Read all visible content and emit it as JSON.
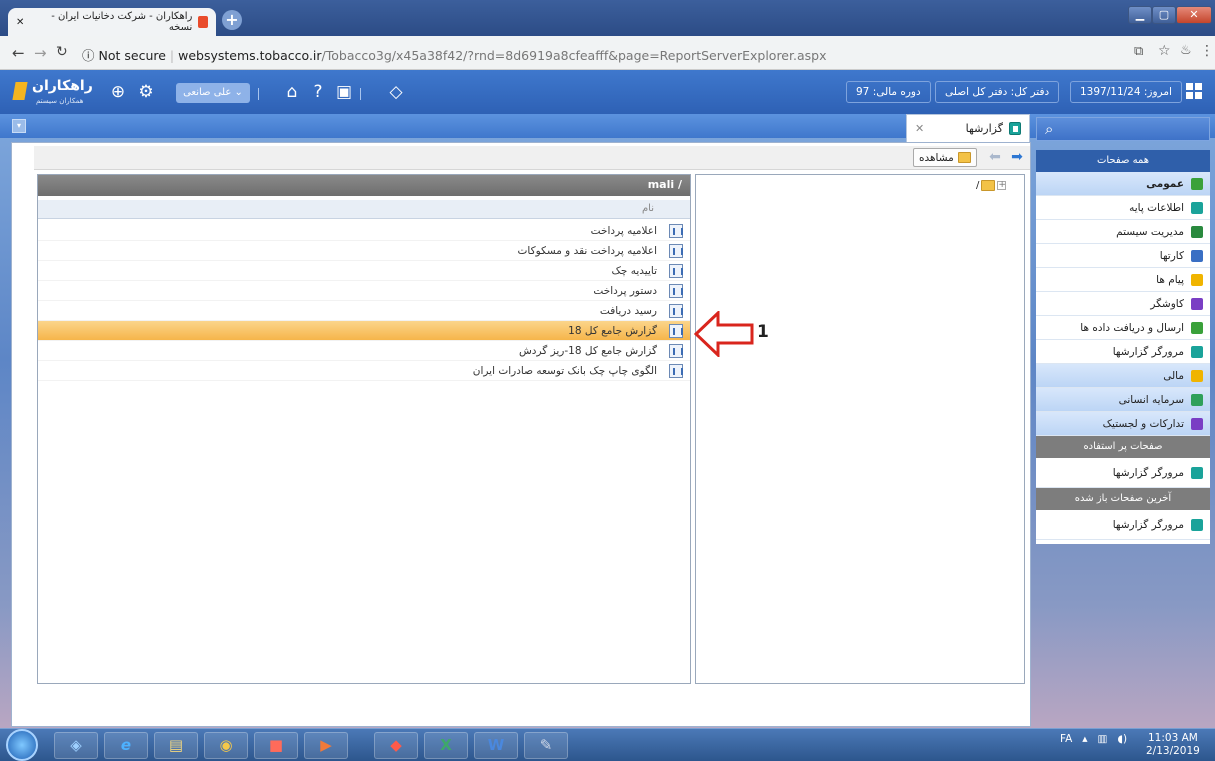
{
  "browser": {
    "tab_title": "راهکاران - شرکت دخانیات ایران - نسخه",
    "new_tab": "+",
    "url_security": "Not secure",
    "url_host": "websystems.tobacco.ir",
    "url_path": "/Tobacco3g/x45a38f42/?rnd=8d6919a8cfeafff&page=ReportServerExplorer.aspx"
  },
  "header": {
    "logo_text": "راهکاران",
    "logo_sub": "همکاران سیستم",
    "user_name": "علی صانعی",
    "today": "امروز: 1397/11/24",
    "office": "دفتر کل: دفتر کل اصلی",
    "fiscal_period": "دوره مالی: 97"
  },
  "tabs": {
    "reports": "گزارشها"
  },
  "toolbar": {
    "view_label": "مشاهده"
  },
  "tree": {
    "root": "/"
  },
  "list": {
    "path": "mali /",
    "column_name": "نام",
    "rows": [
      "اعلامیه پرداخت",
      "اعلامیه پرداخت نقد و مسکوکات",
      "تاییدیه چک",
      "دستور پرداخت",
      "رسید دریافت",
      "گزارش جامع کل 18",
      "گزارش جامع کل 18-ریز گردش",
      "الگوی چاپ چک بانک توسعه صادرات ایران"
    ],
    "selected_index": 5,
    "annotation": "1"
  },
  "sidebar": {
    "all_pages": "همه صفحات",
    "items": [
      {
        "label": "عمومی",
        "color": "#3aa13a"
      },
      {
        "label": "اطلاعات پایه",
        "color": "#1aa39a"
      },
      {
        "label": "مدیریت سیستم",
        "color": "#2a8a3e"
      },
      {
        "label": "کارتها",
        "color": "#3a6fc4"
      },
      {
        "label": "پیام ها",
        "color": "#f0b400"
      },
      {
        "label": "کاوشگر",
        "color": "#7a3ec4"
      },
      {
        "label": "ارسال و دریافت داده ها",
        "color": "#3aa13a"
      },
      {
        "label": "مرورگر گزارشها",
        "color": "#1aa39a"
      },
      {
        "label": "مالی",
        "color": "#f0b400"
      },
      {
        "label": "سرمایه انسانی",
        "color": "#2fa05a"
      },
      {
        "label": "تدارکات و لجستیک",
        "color": "#7a3ec4"
      }
    ],
    "frequent_title": "صفحات پر استفاده",
    "frequent_items": [
      "مرورگر گزارشها"
    ],
    "recent_title": "آخرین صفحات باز شده",
    "recent_items": [
      "مرورگر گزارشها"
    ]
  },
  "taskbar": {
    "lang": "FA",
    "time": "11:03 AM",
    "date": "2/13/2019"
  }
}
